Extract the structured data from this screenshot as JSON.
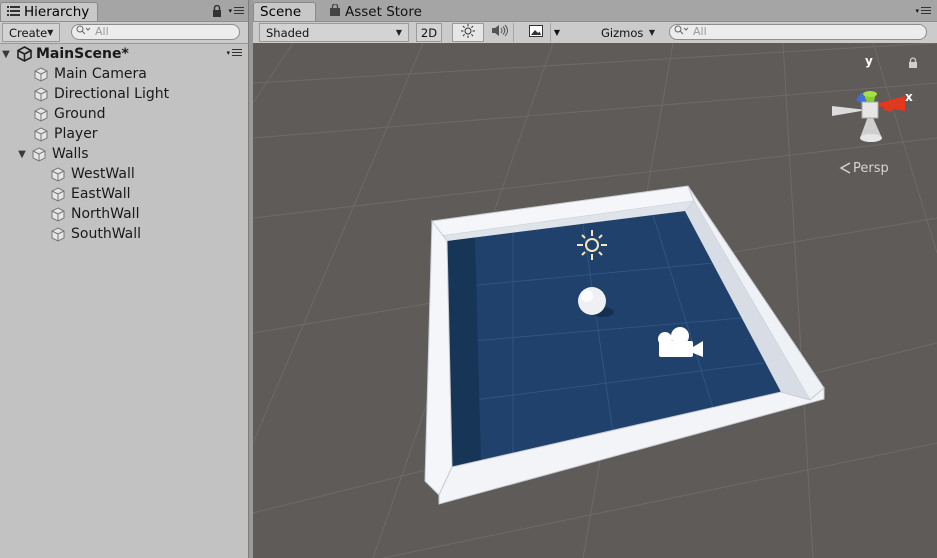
{
  "hierarchy": {
    "tab_label": "Hierarchy",
    "create_label": "Create",
    "search_placeholder": "All",
    "scene_name": "MainScene*",
    "items": [
      {
        "label": "Main Camera"
      },
      {
        "label": "Directional Light"
      },
      {
        "label": "Ground"
      },
      {
        "label": "Player"
      },
      {
        "label": "Walls"
      },
      {
        "label": "WestWall"
      },
      {
        "label": "EastWall"
      },
      {
        "label": "NorthWall"
      },
      {
        "label": "SouthWall"
      }
    ]
  },
  "scene": {
    "tabs": [
      {
        "label": "Scene"
      },
      {
        "label": "Asset Store"
      }
    ],
    "toolbar": {
      "shading_mode": "Shaded",
      "mode_2d": "2D",
      "gizmos_label": "Gizmos",
      "search_placeholder": "All"
    },
    "gizmo": {
      "y_label": "y",
      "x_label": "x",
      "projection_label": "Persp"
    }
  },
  "colors": {
    "viewport_bg": "#5f5b58",
    "floor": "#1f416b",
    "wall": "#f2f4f8",
    "gizmo_x": "#e2381e",
    "gizmo_y": "#8acc2c",
    "gizmo_z": "#3f6fd8"
  },
  "icons": [
    "list-icon",
    "lock-icon",
    "menu-icon",
    "search-icon",
    "unity-logo-icon",
    "gameobject-cube-icon",
    "foldout-arrow-icon",
    "asset-store-bag-icon",
    "sun-icon",
    "audio-icon",
    "image-effects-icon",
    "camera-gizmo-icon",
    "light-gizmo-icon"
  ]
}
